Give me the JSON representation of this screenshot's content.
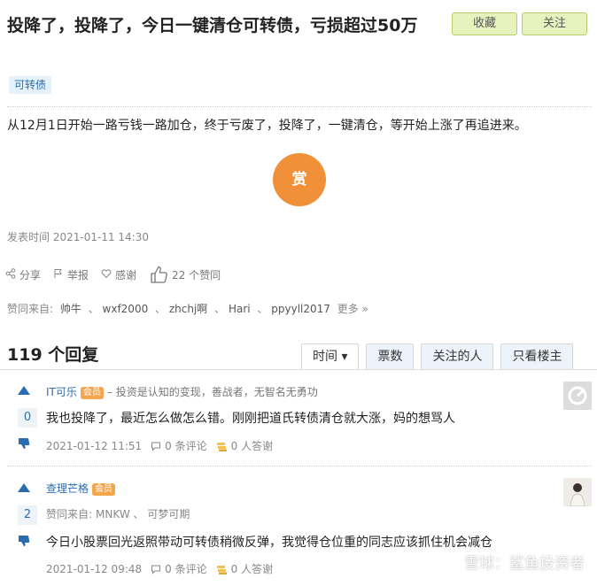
{
  "post": {
    "title": "投降了，投降了，今日一键清仓可转债，亏损超过50万",
    "tag": "可转债",
    "content": "从12月1日开始一路亏钱一路加仓，终于亏废了，投降了，一键清仓，等开始上涨了再追进来。",
    "reward_label": "赏",
    "time_prefix": "发表时间",
    "time": "2021-01-11 14:30"
  },
  "header_buttons": {
    "collect": "收藏",
    "follow": "关注"
  },
  "actions": {
    "share": "分享",
    "report": "举报",
    "thanks": "感谢",
    "like_count": "22 个赞同"
  },
  "likers": {
    "prefix": "赞同来自:",
    "names": [
      "帅牛",
      "wxf2000",
      "zhchj啊",
      "Hari",
      "ppyyll2017"
    ],
    "more": "更多 »"
  },
  "replies_header": {
    "count_title": "119 个回复",
    "tabs": [
      "时间 ▾",
      "票数",
      "关注的人",
      "只看楼主"
    ]
  },
  "replies": [
    {
      "user": "IT可乐",
      "vip": "会员",
      "bio": "– 投资是认知的变现，善战者，无智名无勇功",
      "votes": "0",
      "text": "我也投降了，最近怎么做怎么错。刚刚把道氏转债清仓就大涨，妈的想骂人",
      "time": "2021-01-12 11:51",
      "comments": "0 条评论",
      "answers": "0 人答谢"
    },
    {
      "user": "查理芒格",
      "vip": "会员",
      "likers_prefix": "赞同来自:",
      "likers": "MNKW 、 可梦可期",
      "votes": "2",
      "text": "今日小股票回光返照带动可转债稍微反弹，我觉得仓位重的同志应该抓住机会减仓",
      "time": "2021-01-12 09:48",
      "comments": "0 条评论",
      "answers": "0 人答谢"
    }
  ],
  "watermark": "雪球：鲨鱼投资者",
  "colors": {
    "accent": "#2b6cb0",
    "reward": "#f0913a",
    "button_bg": "#e7f2bd",
    "vip": "#f4a64f"
  }
}
